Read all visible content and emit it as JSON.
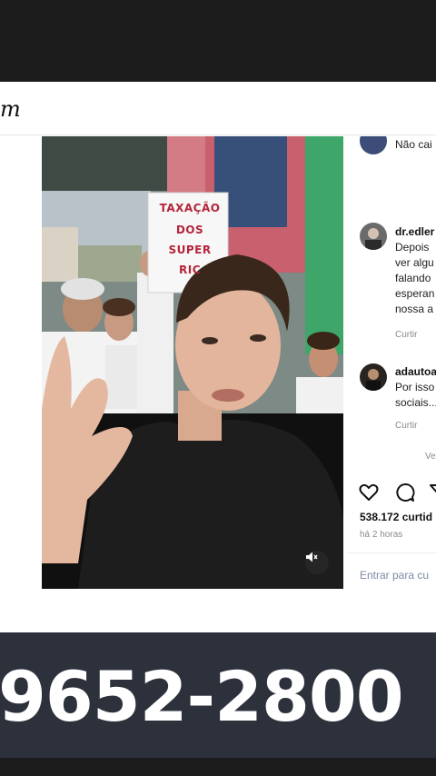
{
  "header": {
    "logo_fragment": "m"
  },
  "post": {
    "sign_lines": [
      "TAXAÇÃO",
      "DOS",
      "SUPER",
      "RIC"
    ],
    "mute_icon": "speaker-muted-icon"
  },
  "comments": [
    {
      "user": "",
      "lines": [
        "Não cai"
      ],
      "meta": ""
    },
    {
      "user": "dr.edler",
      "lines": [
        "Depois",
        "ver algu",
        "falando",
        "esperan",
        "nossa a"
      ],
      "meta": "Curtir"
    },
    {
      "user": "adautoa",
      "lines": [
        "Por isso",
        "sociais..."
      ],
      "meta": "Curtir"
    }
  ],
  "more_replies": "Ve",
  "actions": {
    "likes": "538.172 curtid",
    "time": "há 2 horas"
  },
  "login_prompt": "Entrar para cu",
  "banner": {
    "phone": "9652-2800"
  },
  "colors": {
    "sign": "#b5253c",
    "banner": "#2c313b",
    "link": "#7b8aa3"
  }
}
